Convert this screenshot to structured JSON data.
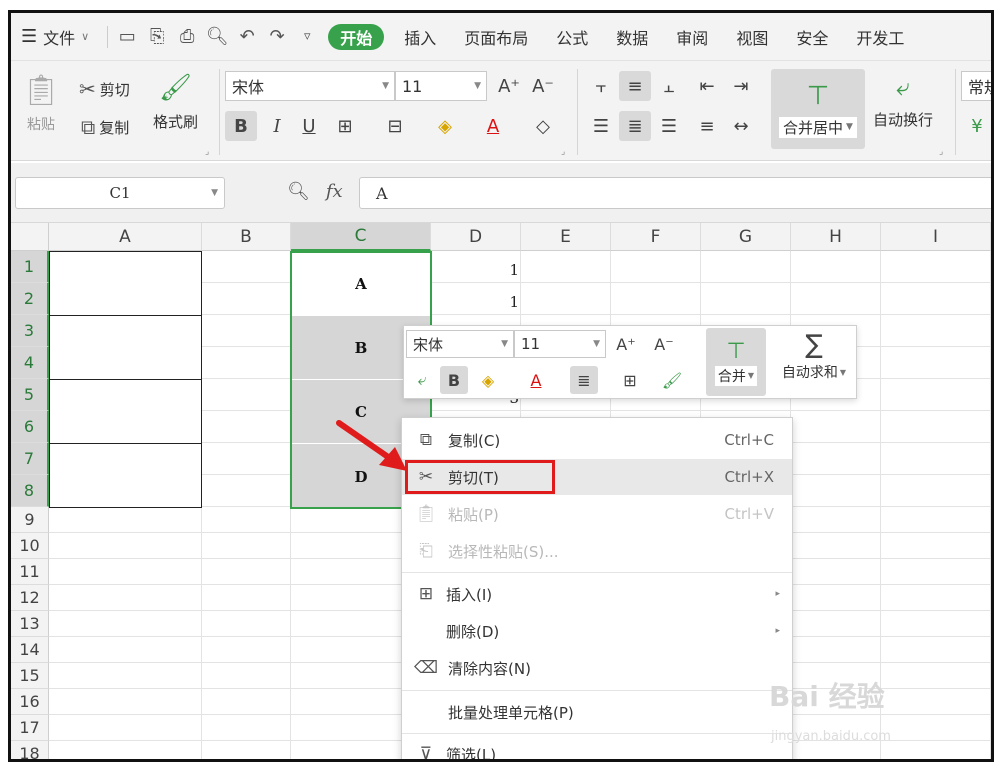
{
  "menubar": {
    "file_label": "文件",
    "tabs": [
      {
        "label": "开始",
        "active": true
      },
      {
        "label": "插入"
      },
      {
        "label": "页面布局"
      },
      {
        "label": "公式"
      },
      {
        "label": "数据"
      },
      {
        "label": "审阅"
      },
      {
        "label": "视图"
      },
      {
        "label": "安全"
      },
      {
        "label": "开发工"
      }
    ],
    "accent_color": "#37a24b"
  },
  "ribbon": {
    "paste_label": "粘贴",
    "cut_label": "剪切",
    "copy_label": "复制",
    "format_painter_label": "格式刷",
    "font_name": "宋体",
    "font_size": "11",
    "merge_center_label": "合并居中",
    "wrap_text_label": "自动换行",
    "number_format_label": "常规"
  },
  "formula_bar": {
    "cell_ref": "C1",
    "fx_label": "fx",
    "formula_value": "A"
  },
  "grid": {
    "columns": [
      "A",
      "B",
      "C",
      "D",
      "E",
      "F",
      "G",
      "H",
      "I"
    ],
    "selected_column": "C",
    "rows": [
      "1",
      "2",
      "3",
      "4",
      "5",
      "6",
      "7",
      "8",
      "9",
      "10",
      "11",
      "12",
      "13",
      "14",
      "15",
      "16",
      "17",
      "18"
    ],
    "merged_c_values": [
      "A",
      "B",
      "C",
      "D"
    ],
    "d_values": [
      "1",
      "1",
      "3"
    ]
  },
  "mini_toolbar": {
    "font_name": "宋体",
    "font_size": "11",
    "merge_label": "合并",
    "autosum_label": "自动求和"
  },
  "context_menu": {
    "items": [
      {
        "label": "复制(C)",
        "shortcut": "Ctrl+C",
        "icon": "copy-icon"
      },
      {
        "label": "剪切(T)",
        "shortcut": "Ctrl+X",
        "icon": "scissors-icon",
        "highlighted": true
      },
      {
        "label": "粘贴(P)",
        "shortcut": "Ctrl+V",
        "icon": "paste-icon",
        "disabled": true
      },
      {
        "label": "选择性粘贴(S)...",
        "icon": "paste-special-icon",
        "disabled": true
      },
      {
        "label": "插入(I)",
        "icon": "insert-icon",
        "submenu": true
      },
      {
        "label": "删除(D)",
        "submenu": true
      },
      {
        "label": "清除内容(N)",
        "icon": "eraser-icon"
      },
      {
        "label": "批量处理单元格(P)"
      },
      {
        "label": "筛选(L)",
        "icon": "filter-icon"
      }
    ]
  },
  "watermark": {
    "brand": "Bai 经验",
    "url": "jingyan.baidu.com"
  }
}
